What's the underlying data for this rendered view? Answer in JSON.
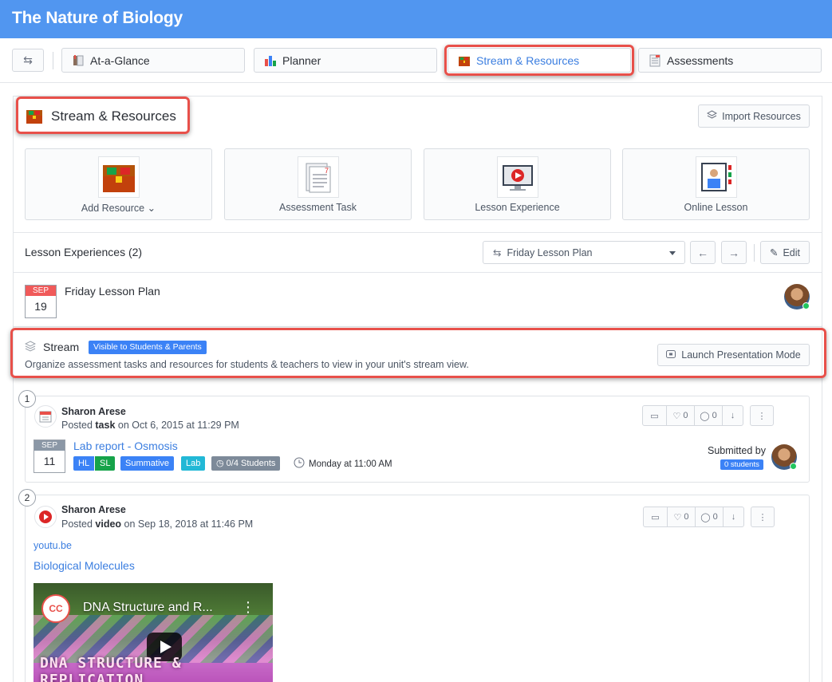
{
  "app": {
    "title": "The Nature of Biology"
  },
  "tabs": [
    {
      "label": "At-a-Glance"
    },
    {
      "label": "Planner"
    },
    {
      "label": "Stream & Resources"
    },
    {
      "label": "Assessments"
    }
  ],
  "section": {
    "title": "Stream & Resources",
    "import_label": "Import Resources"
  },
  "resource_cards": [
    {
      "label": "Add Resource ⌄"
    },
    {
      "label": "Assessment Task"
    },
    {
      "label": "Lesson Experience"
    },
    {
      "label": "Online Lesson"
    }
  ],
  "lesson_experiences": {
    "title": "Lesson Experiences (2)",
    "selected_plan": "Friday Lesson Plan",
    "edit_label": "Edit"
  },
  "lesson_plan": {
    "month": "SEP",
    "day": "19",
    "name": "Friday Lesson Plan"
  },
  "stream": {
    "title": "Stream",
    "visibility_badge": "Visible to Students & Parents",
    "description": "Organize assessment tasks and resources for students & teachers to view in your unit's stream view.",
    "launch_label": "Launch Presentation Mode"
  },
  "posts": [
    {
      "number": "1",
      "author": "Sharon Arese",
      "posted_prefix": "Posted ",
      "posted_type": "task",
      "posted_suffix": " on Oct 6, 2015 at 11:29 PM",
      "likes": "0",
      "comments": "0",
      "date_month": "SEP",
      "date_day": "11",
      "task_title": "Lab report - Osmosis",
      "tags": [
        "HL",
        "SL",
        "Summative",
        "Lab",
        "0/4 Students"
      ],
      "due": "Monday at 11:00 AM",
      "submitted_label": "Submitted by",
      "submitted_badge": "0 students"
    },
    {
      "number": "2",
      "author": "Sharon Arese",
      "posted_prefix": "Posted ",
      "posted_type": "video",
      "posted_suffix": " on Sep 18, 2018 at 11:46 PM",
      "likes": "0",
      "comments": "0",
      "source": "youtu.be",
      "video_title": "Biological Molecules",
      "video": {
        "logo_text": "CC",
        "overlay_title": "DNA Structure and R...",
        "frame_text": "DNA STRUCTURE & REPLICATION"
      }
    }
  ],
  "colors": {
    "topbar": "#5196f0",
    "highlight": "#e8504a",
    "link": "#3b7ee0",
    "badge_blue": "#3b82f6",
    "badge_green": "#16a34a",
    "badge_cyan": "#22b8d6",
    "badge_gray": "#7d8a99",
    "date_red": "#f05a5a",
    "date_gray": "#8b97a6",
    "online": "#22c55e"
  }
}
